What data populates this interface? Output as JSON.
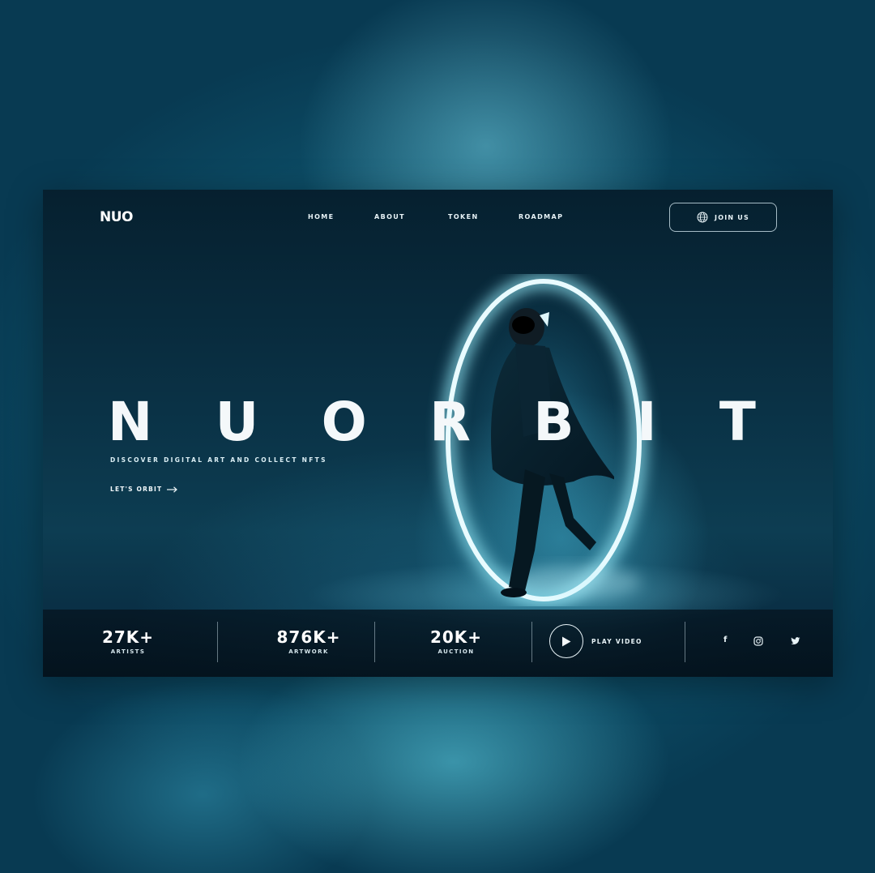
{
  "brand": {
    "logo": "NUO"
  },
  "nav": {
    "items": [
      {
        "label": "HOME"
      },
      {
        "label": "ABOUT"
      },
      {
        "label": "TOKEN"
      },
      {
        "label": "ROADMAP"
      }
    ],
    "join_label": "JOIN US"
  },
  "hero": {
    "title_letters": [
      "N",
      "U",
      "O",
      "R",
      "B",
      "I",
      "T"
    ],
    "tagline": "DISCOVER DIGITAL ART AND COLLECT NFTS",
    "cta_label": "LET'S ORBIT"
  },
  "stats": [
    {
      "value": "27K+",
      "label": "ARTISTS"
    },
    {
      "value": "876K+",
      "label": "ARTWORK"
    },
    {
      "value": "20K+",
      "label": "AUCTION"
    }
  ],
  "video": {
    "label": "PLAY VIDEO"
  },
  "social": {
    "facebook": "f",
    "twitter_icon": "twitter-icon",
    "instagram_icon": "instagram-icon"
  },
  "colors": {
    "accent_glow": "#8fe3f2",
    "background": "#0c4a63",
    "card_bg": "#0a3246",
    "text": "#f4f8fa"
  }
}
